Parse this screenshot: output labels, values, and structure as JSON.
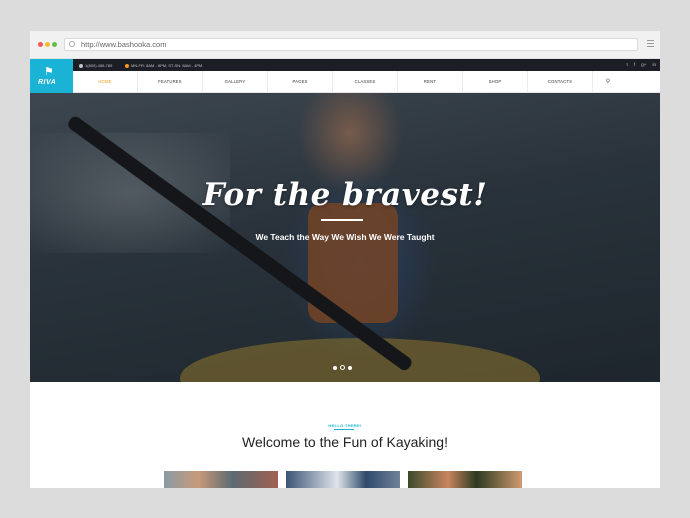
{
  "browser": {
    "url": "http://www.bashooka.com"
  },
  "site": {
    "logo_text": "RIVA",
    "topbar": {
      "phone": "1(800) 456-789",
      "hours": "MN-FR: 8AM - 8PM; ST-SN: 8AM - 4PM",
      "social": [
        "t",
        "f",
        "g+",
        "in"
      ]
    },
    "nav": {
      "items": [
        {
          "label": "HOME",
          "active": true
        },
        {
          "label": "FEATURES"
        },
        {
          "label": "GALLERY"
        },
        {
          "label": "PAGES"
        },
        {
          "label": "CLASSES"
        },
        {
          "label": "RENT"
        },
        {
          "label": "SHOP"
        },
        {
          "label": "CONTACTS"
        }
      ],
      "search_icon": "search-icon"
    },
    "hero": {
      "title": "For the bravest!",
      "subtitle": "We Teach the Way We Wish We Were Taught",
      "slides": 3,
      "active_slide": 2
    },
    "intro": {
      "kicker": "HELLO THERE!",
      "title": "Welcome to the Fun of Kayaking!"
    }
  },
  "colors": {
    "accent": "#1ab3d6",
    "nav_active": "#f39a1c",
    "topbar": "#1b1e24"
  }
}
